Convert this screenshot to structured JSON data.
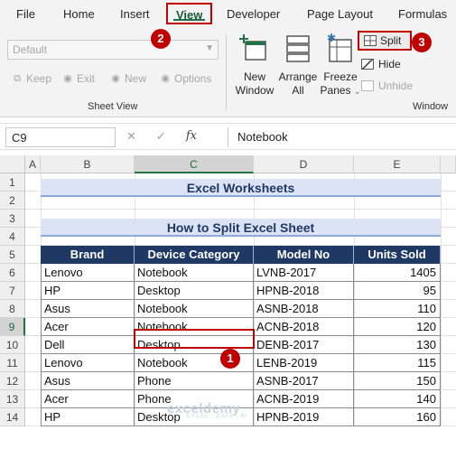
{
  "ribbon_tabs": [
    "File",
    "Home",
    "Insert",
    "View",
    "Developer",
    "Page Layout",
    "Formulas"
  ],
  "active_tab": "View",
  "sheet_view": {
    "dropdown_value": "Default",
    "keep": "Keep",
    "exit": "Exit",
    "new": "New",
    "options": "Options",
    "group_label": "Sheet View"
  },
  "window_group": {
    "new_window": [
      "New",
      "Window"
    ],
    "arrange_all": [
      "Arrange",
      "All"
    ],
    "freeze_panes": [
      "Freeze",
      "Panes"
    ],
    "split": "Split",
    "hide": "Hide",
    "unhide": "Unhide",
    "group_label": "Window"
  },
  "badges": [
    "1",
    "2",
    "3"
  ],
  "formula_bar": {
    "name_box": "C9",
    "fx": "fx",
    "value": "Notebook"
  },
  "columns": [
    "A",
    "B",
    "C",
    "D",
    "E"
  ],
  "rows": [
    "1",
    "2",
    "3",
    "4",
    "5",
    "6",
    "7",
    "8",
    "9",
    "10",
    "11",
    "12",
    "13",
    "14"
  ],
  "sheet": {
    "title": "Excel Worksheets",
    "subtitle": "How to Split Excel Sheet",
    "headers": [
      "Brand",
      "Device Category",
      "Model No",
      "Units Sold"
    ],
    "rows": [
      [
        "Lenovo",
        "Notebook",
        "LVNB-2017",
        "1405"
      ],
      [
        "HP",
        "Desktop",
        "HPNB-2018",
        "95"
      ],
      [
        "Asus",
        "Notebook",
        "ASNB-2018",
        "110"
      ],
      [
        "Acer",
        "Notebook",
        "ACNB-2018",
        "120"
      ],
      [
        "Dell",
        "Desktop",
        "DENB-2017",
        "130"
      ],
      [
        "Lenovo",
        "Notebook",
        "LENB-2019",
        "115"
      ],
      [
        "Asus",
        "Phone",
        "ASNB-2017",
        "150"
      ],
      [
        "Acer",
        "Phone",
        "ACNB-2019",
        "140"
      ],
      [
        "HP",
        "Desktop",
        "HPNB-2019",
        "160"
      ]
    ]
  },
  "watermark": {
    "name": "exceldemy",
    "tagline": "EXCEL · DATA · BI"
  },
  "colors": {
    "accent_red": "#c00000",
    "header_navy": "#1f3864",
    "title_band": "#dbe3f4",
    "excel_green": "#217346"
  }
}
